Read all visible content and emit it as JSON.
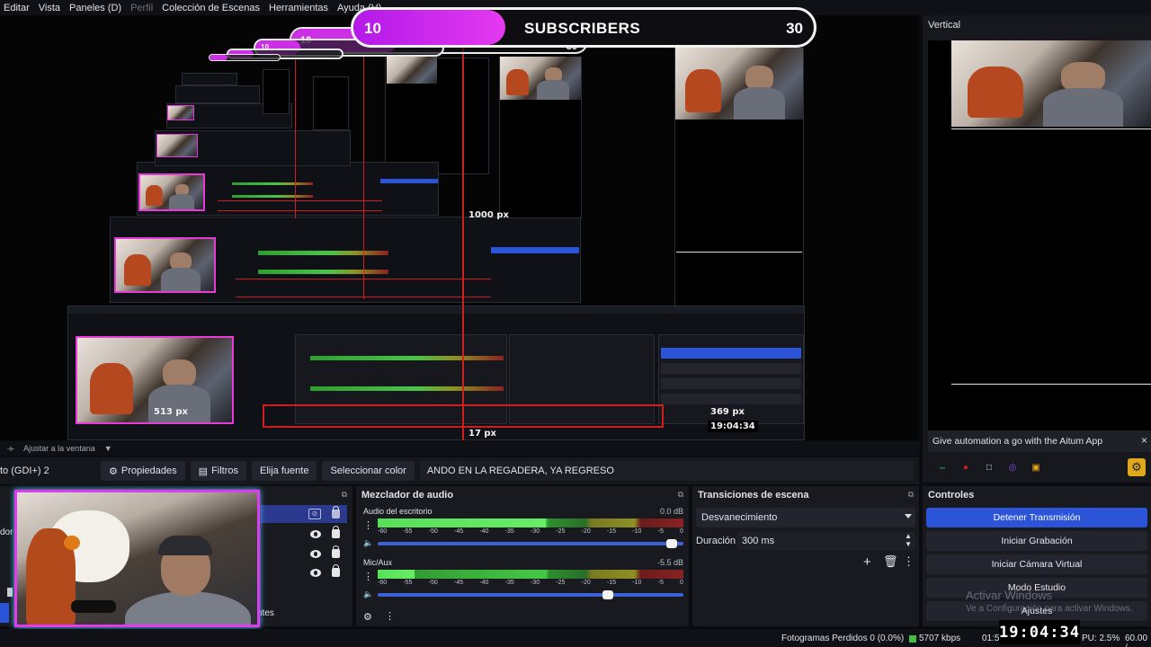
{
  "menu": [
    "Editar",
    "Vista",
    "Paneles (D)",
    "Perfil",
    "Colección de Escenas",
    "Herramientas",
    "Ayuda (H)"
  ],
  "subscriber_goal": {
    "current": "10",
    "label": "SUBSCRIBERS",
    "target": "30",
    "progress": 0.33
  },
  "nested_overlays": {
    "px_1000": "1000 px",
    "px_513": "513 px",
    "px_369": "369 px",
    "px_17": "17 px",
    "ghost_current": "10",
    "ghost_target": "30"
  },
  "vertical_panel": {
    "title": "Vertical",
    "aitum_text": "Give automation a go with the Aitum App",
    "close_icon": "×"
  },
  "resize_row": {
    "label": "Ajustar a la ventana"
  },
  "source_toolbar": {
    "source_name": "to (GDI+) 2",
    "properties": "Propiedades",
    "filters": "Filtros",
    "choose_source": "Elija fuente",
    "select_color": "Seleccionar color",
    "scene_text": "ANDO EN LA REGADERA, YA REGRESO"
  },
  "sources_dock": {
    "left_label": "dor",
    "bottom_label": "ntes"
  },
  "mixer": {
    "title": "Mezclador de audio",
    "channels": [
      {
        "name": "Audio del escritorio",
        "db": "0.0 dB",
        "level": 0.55,
        "volume": 0.98
      },
      {
        "name": "Mic/Aux",
        "db": "-5.5 dB",
        "level": 0.12,
        "volume": 0.77
      }
    ],
    "ticks": [
      "-60",
      "-55",
      "-50",
      "-45",
      "-40",
      "-35",
      "-30",
      "-25",
      "-20",
      "-15",
      "-10",
      "-5",
      "0"
    ]
  },
  "transitions": {
    "title": "Transiciones de escena",
    "selected": "Desvanecimiento",
    "duration_label": "Duración",
    "duration_value": "300 ms"
  },
  "controls": {
    "title": "Controles",
    "buttons": [
      "Detener Transmisión",
      "Iniciar Grabación",
      "Iniciar Cámara Virtual",
      "Modo Estudio",
      "Ajustes"
    ]
  },
  "status": {
    "frames": "Fotogramas Perdidos 0 (0.0%)",
    "bitrate": "5707 kbps",
    "rec_time": "01:5",
    "cpu": "PU: 2.5%",
    "fps": "60.00 /"
  },
  "clock": "19:04:34",
  "watermark": {
    "title": "Activar Windows",
    "sub": "Ve a Configuración para activar Windows."
  },
  "colors": {
    "accent_blue": "#2b54d9",
    "goal_magenta": "#e43af0",
    "frame_pink": "#df3cf2",
    "gear_yellow": "#e0a81b"
  }
}
